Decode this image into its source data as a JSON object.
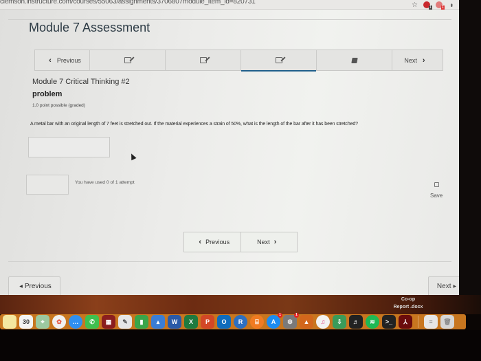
{
  "browser": {
    "url": "clemson.instructure.com/courses/55063/assignments/3706807module_item_id=820731",
    "extensions": [
      {
        "name": "ext-1",
        "badge": "1",
        "color": "#c9282d"
      },
      {
        "name": "ext-2",
        "badge": "1",
        "color": "#e17b7b"
      }
    ]
  },
  "page": {
    "title": "Module 7 Assessment"
  },
  "module_nav": {
    "previous_label": "Previous",
    "next_label": "Next",
    "items": [
      {
        "icon": "edit-icon",
        "active": false
      },
      {
        "icon": "edit-icon",
        "active": false
      },
      {
        "icon": "edit-icon",
        "active": true
      },
      {
        "icon": "book-icon",
        "active": false
      }
    ]
  },
  "problem": {
    "heading": "Module 7 Critical Thinking #2",
    "subheading": "problem",
    "points": "1.0 point possible (graded)",
    "question": "A metal bar with an original length of 7 feet is stretched out. If the material experiences a strain of 50%, what is the length of the bar after it has been stretched?",
    "answer_value": "",
    "attempts_text": "You have used 0 of 1 attempt",
    "save_label": "Save"
  },
  "sequence_nav": {
    "previous_label": "Previous",
    "next_label": "Next"
  },
  "footer_nav": {
    "previous_label": "Previous",
    "next_label": "Next"
  },
  "desktop": {
    "file_label_line1": "Co-op",
    "file_label_line2": "Report .docx"
  },
  "dock": {
    "apps": [
      {
        "name": "notes",
        "glyph": "",
        "color": "#f3e7a0"
      },
      {
        "name": "calendar",
        "glyph": "30",
        "color": "#f4f4f4",
        "text_color": "#333"
      },
      {
        "name": "maps",
        "glyph": "⌖",
        "color": "#9cc9a0"
      },
      {
        "name": "photos",
        "glyph": "✿",
        "color": "#f1f1f1",
        "text_color": "#e5533b",
        "round": true
      },
      {
        "name": "messages",
        "glyph": "…",
        "color": "#2f8ff0",
        "round": true
      },
      {
        "name": "facetime",
        "glyph": "✆",
        "color": "#3fbf4f"
      },
      {
        "name": "photo-booth",
        "glyph": "▦",
        "color": "#8b1e1e"
      },
      {
        "name": "textedit",
        "glyph": "✎",
        "color": "#e6e6e6",
        "text_color": "#555"
      },
      {
        "name": "numbers",
        "glyph": "▮",
        "color": "#3aa54a"
      },
      {
        "name": "keynote",
        "glyph": "▴",
        "color": "#3a7dd6"
      },
      {
        "name": "word",
        "glyph": "W",
        "color": "#2a5aa8"
      },
      {
        "name": "excel",
        "glyph": "X",
        "color": "#1f7a3f"
      },
      {
        "name": "powerpoint",
        "glyph": "P",
        "color": "#d24726"
      },
      {
        "name": "outlook",
        "glyph": "O",
        "color": "#0f6cbd"
      },
      {
        "name": "r",
        "glyph": "R",
        "color": "#2c6fc1",
        "round": true
      },
      {
        "name": "books",
        "glyph": "⌸",
        "color": "#f07b22",
        "round": true
      },
      {
        "name": "app-store",
        "glyph": "A",
        "color": "#1c8cf0",
        "round": true,
        "badge": "1"
      },
      {
        "name": "system-preferences",
        "glyph": "⚙",
        "color": "#7a7a7a",
        "badge": "1"
      },
      {
        "name": "matlab",
        "glyph": "▲",
        "color": "#d2661c"
      },
      {
        "name": "itunes",
        "glyph": "♫",
        "color": "#f2f2f2",
        "text_color": "#e23a7a",
        "round": true
      },
      {
        "name": "downloader",
        "glyph": "⇩",
        "color": "#3a9b5a"
      },
      {
        "name": "piano",
        "glyph": "♬",
        "color": "#222"
      },
      {
        "name": "spotify",
        "glyph": "≋",
        "color": "#1db954",
        "round": true
      },
      {
        "name": "terminal",
        "glyph": ">_",
        "color": "#222"
      },
      {
        "name": "acrobat",
        "glyph": "⅄",
        "color": "#6b0c0c"
      }
    ],
    "trailing": [
      {
        "name": "document-stack",
        "glyph": "≡",
        "color": "#e6e6e6",
        "text_color": "#888"
      },
      {
        "name": "trash",
        "glyph": "🗑",
        "color": "#d6d6d6",
        "text_color": "#888"
      }
    ]
  }
}
